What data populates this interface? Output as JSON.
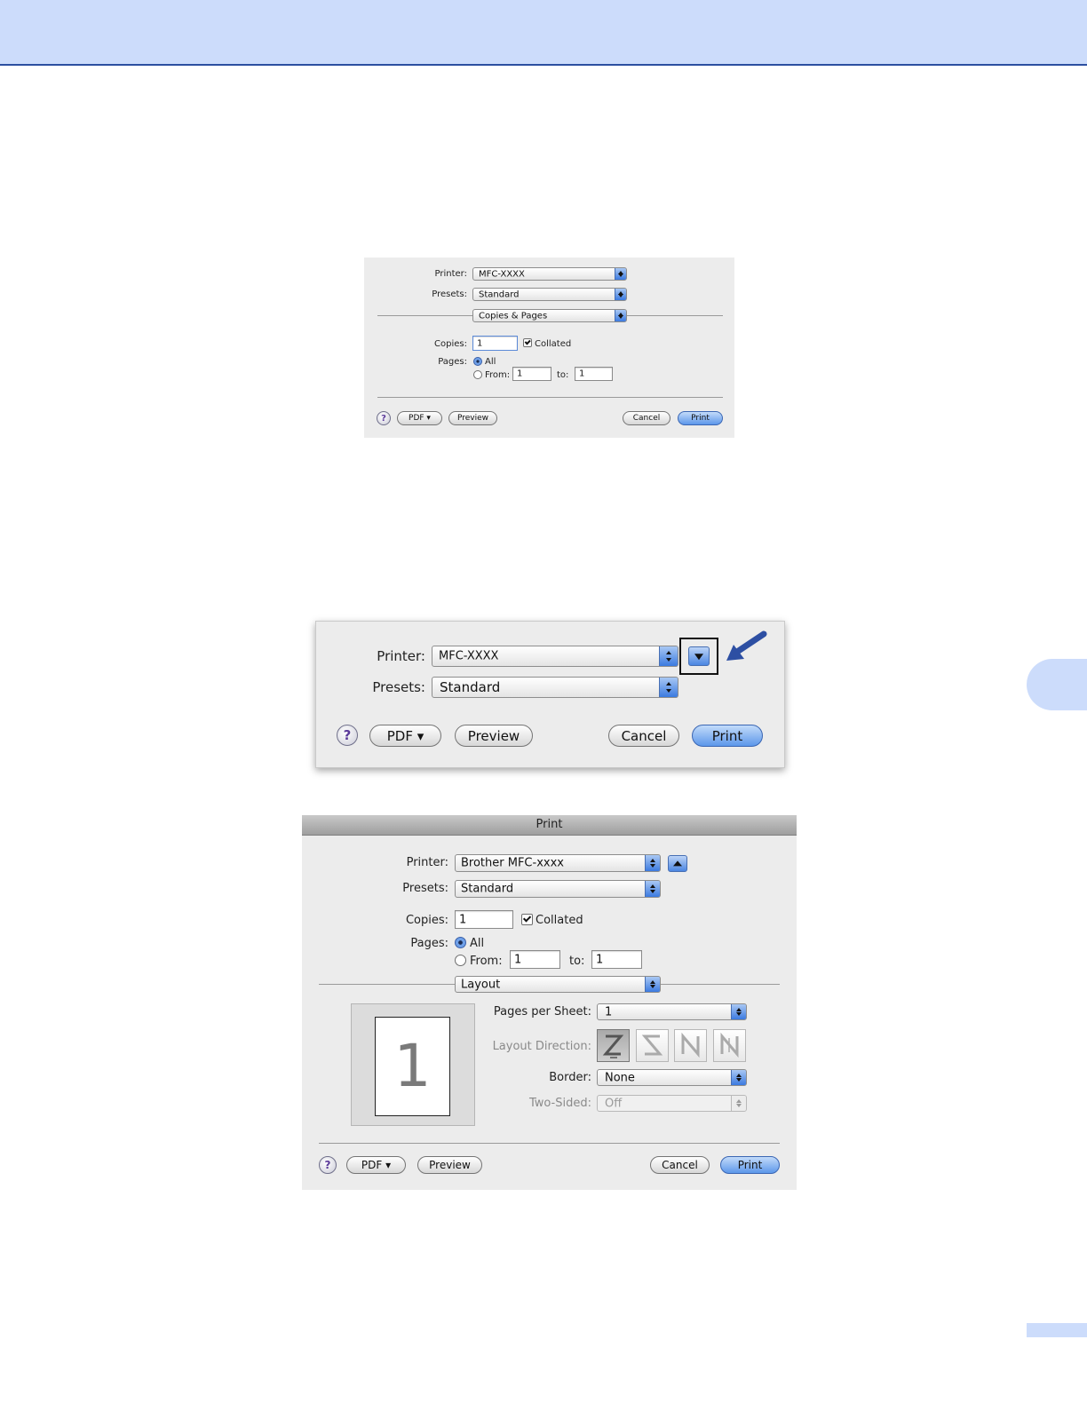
{
  "dialog1": {
    "printer_label": "Printer:",
    "printer_value": "MFC-XXXX",
    "presets_label": "Presets:",
    "presets_value": "Standard",
    "panel_value": "Copies & Pages",
    "copies_label": "Copies:",
    "copies_value": "1",
    "collated_label": "Collated",
    "pages_label": "Pages:",
    "all_label": "All",
    "from_label": "From:",
    "from_value": "1",
    "to_label": "to:",
    "to_value": "1",
    "help_glyph": "?",
    "pdf_label": "PDF ▾",
    "preview_label": "Preview",
    "cancel_label": "Cancel",
    "print_label": "Print"
  },
  "dialog2": {
    "printer_label": "Printer:",
    "printer_value": "MFC-XXXX",
    "presets_label": "Presets:",
    "presets_value": "Standard",
    "help_glyph": "?",
    "pdf_label": "PDF ▾",
    "preview_label": "Preview",
    "cancel_label": "Cancel",
    "print_label": "Print"
  },
  "dialog3": {
    "title": "Print",
    "printer_label": "Printer:",
    "printer_value": "Brother MFC-xxxx",
    "presets_label": "Presets:",
    "presets_value": "Standard",
    "copies_label": "Copies:",
    "copies_value": "1",
    "collated_label": "Collated",
    "pages_label": "Pages:",
    "all_label": "All",
    "from_label": "From:",
    "from_value": "1",
    "to_label": "to:",
    "to_value": "1",
    "panel_value": "Layout",
    "preview_page_number": "1",
    "pages_per_sheet_label": "Pages per Sheet:",
    "pages_per_sheet_value": "1",
    "layout_direction_label": "Layout Direction:",
    "border_label": "Border:",
    "border_value": "None",
    "two_sided_label": "Two-Sided:",
    "two_sided_value": "Off",
    "help_glyph": "?",
    "pdf_label": "PDF ▾",
    "preview_label": "Preview",
    "cancel_label": "Cancel",
    "print_label": "Print"
  },
  "colors": {
    "header_band": "#ccdcfb",
    "header_rule": "#2c4fa0",
    "primary_button": "#5c97ea",
    "callout_arrow": "#2d4fa3"
  }
}
